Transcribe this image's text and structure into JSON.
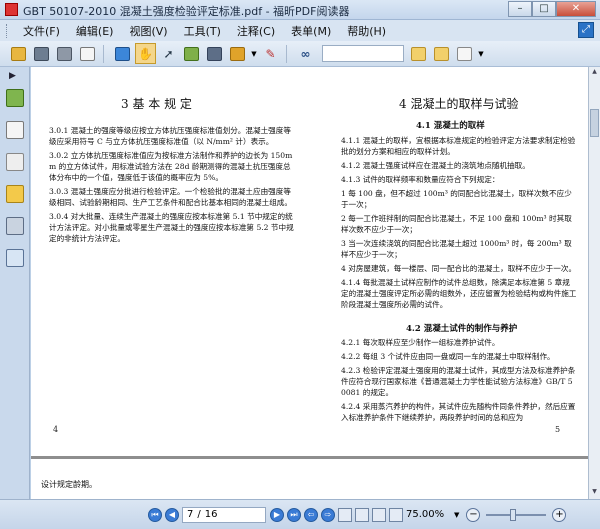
{
  "window": {
    "title": "GBT 50107-2010 混凝土强度检验评定标准.pdf - 福昕PDF阅读器",
    "min_label": "–",
    "max_label": "□",
    "close_label": "✕"
  },
  "menu": {
    "items": [
      {
        "label": "文件(F)"
      },
      {
        "label": "编辑(E)"
      },
      {
        "label": "视图(V)"
      },
      {
        "label": "工具(T)"
      },
      {
        "label": "注释(C)"
      },
      {
        "label": "表单(M)"
      },
      {
        "label": "帮助(H)"
      }
    ]
  },
  "toolbar": {
    "search_value": ""
  },
  "document": {
    "left_page": {
      "heading": "3  基 本 规 定",
      "paragraphs": [
        "3.0.1  混凝土的强度等级应按立方体抗压强度标准值划分。混凝土强度等级应采用符号 C 与立方体抗压强度标准值（以 N/mm² 计）表示。",
        "3.0.2  立方体抗压强度标准值应为按标准方法制作和养护的边长为 150mm 的立方体试件，用标准试验方法在 28d 龄期测得的混凝土抗压强度总体分布中的一个值，强度低于该值的概率应为 5%。",
        "3.0.3  混凝土强度应分批进行检验评定。一个检验批的混凝土应由强度等级相同、试验龄期相同、生产工艺条件和配合比基本相同的混凝土组成。",
        "3.0.4  对大批量、连续生产混凝土的强度应按本标准第 5.1 节中规定的统计方法评定。对小批量或零星生产混凝土的强度应按本标准第 5.2 节中规定的非统计方法评定。"
      ],
      "page_number": "4"
    },
    "right_page": {
      "heading": "4  混凝土的取样与试验",
      "section1": "4.1  混凝土的取样",
      "paragraphs1": [
        "4.1.1  混凝土的取样，宜根据本标准规定的检验评定方法要求制定检验批的划分方案和相应的取样计划。",
        "4.1.2  混凝土强度试样应在混凝土的浇筑地点随机抽取。",
        "4.1.3  试件的取样频率和数量应符合下列规定：",
        "1  每 100 盘，但不超过 100m³ 的同配合比混凝土，取样次数不应少于一次；",
        "2  每一工作班拌制的同配合比混凝土，不足 100 盘和 100m³ 时其取样次数不应少于一次；",
        "3  当一次连续浇筑的同配合比混凝土超过 1000m³ 时，每 200m³ 取样不应少于一次；",
        "4  对房屋建筑，每一楼层、同一配合比的混凝土，取样不应少于一次。",
        "4.1.4  每批混凝土试样应制作的试件总组数，除满足本标准第 5 章规定的混凝土强度评定所必需的组数外，还应留置为检验结构或构件施工阶段混凝土强度所必需的试件。"
      ],
      "section2": "4.2  混凝土试件的制作与养护",
      "paragraphs2": [
        "4.2.1  每次取样应至少制作一组标准养护试件。",
        "4.2.2  每组 3 个试件应由同一盘或同一车的混凝土中取样制作。",
        "4.2.3  检验评定混凝土强度用的混凝土试件，其成型方法及标准养护条件应符合现行国家标准《普通混凝土力学性能试验方法标准》GB/T 50081 的规定。",
        "4.2.4  采用蒸汽养护的构件，其试件应先随构件同条件养护，然后应置入标准养护条件下继续养护，两段养护时间的总和应为"
      ],
      "page_number": "5"
    },
    "next_page_text": "设计规定龄期。"
  },
  "statusbar": {
    "current_page": "7",
    "total_pages": "16",
    "page_sep": "/",
    "zoom": "75.00%"
  }
}
